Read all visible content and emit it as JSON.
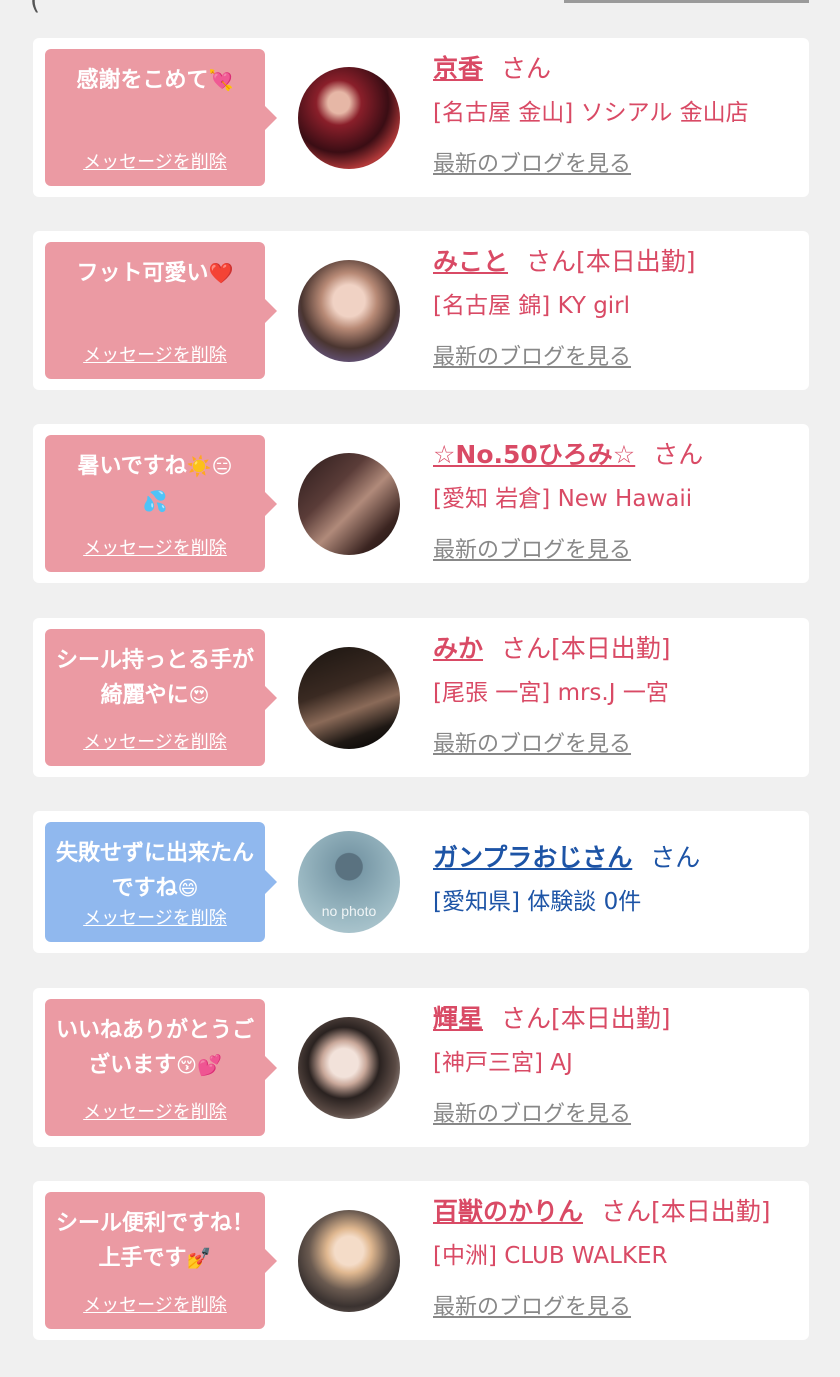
{
  "header": {
    "fragment": "(",
    "underline": ""
  },
  "cards": [
    {
      "color": "pink",
      "message": "感謝をこめて",
      "emoji": "💘",
      "delete_label": "メッセージを削除",
      "name": "京香",
      "san": "さん",
      "status": "",
      "shop": "[名古屋 金山] ソシアル 金山店",
      "blog": "最新のブログを見る",
      "avatar_icon": "photo-avatar"
    },
    {
      "color": "pink",
      "message": "フット可愛い",
      "emoji": "❤️",
      "delete_label": "メッセージを削除",
      "name": "みこと",
      "san": "さん",
      "status": "[本日出勤]",
      "shop": "[名古屋 錦] KY girl",
      "blog": "最新のブログを見る",
      "avatar_icon": "photo-avatar"
    },
    {
      "color": "pink",
      "message": "暑いですね",
      "emoji": "☀️😑💦",
      "delete_label": "メッセージを削除",
      "name": "☆No.50ひろみ☆",
      "san": "さん",
      "status": "",
      "shop": "[愛知 岩倉] New Hawaii",
      "blog": "最新のブログを見る",
      "avatar_icon": "photo-avatar"
    },
    {
      "color": "pink",
      "message": "シール持っとる手が綺麗やに",
      "emoji": "😍",
      "delete_label": "メッセージを削除",
      "name": "みか",
      "san": "さん",
      "status": "[本日出勤]",
      "shop": "[尾張 一宮] mrs.J 一宮",
      "blog": "最新のブログを見る",
      "avatar_icon": "photo-avatar"
    },
    {
      "color": "blue",
      "message": "失敗せずに出来たんですね",
      "emoji": "😄",
      "delete_label": "メッセージを削除",
      "name": "ガンプラおじさん",
      "san": "さん",
      "status": "",
      "shop": "[愛知県] 体験談 0件",
      "blog": "",
      "avatar_icon": "no-photo-avatar",
      "avatar_label": "no photo"
    },
    {
      "color": "pink",
      "message": "いいねありがとうございます",
      "emoji": "😚💕",
      "delete_label": "メッセージを削除",
      "name": "輝星",
      "san": "さん",
      "status": "[本日出勤]",
      "shop": "[神戸三宮] AJ",
      "blog": "最新のブログを見る",
      "avatar_icon": "photo-avatar"
    },
    {
      "color": "pink",
      "message": "シール便利ですね！上手です",
      "emoji": "💅",
      "delete_label": "メッセージを削除",
      "name": "百獣のかりん",
      "san": "さん",
      "status": "[本日出勤]",
      "shop": "[中洲] CLUB WALKER",
      "blog": "最新のブログを見る",
      "avatar_icon": "photo-avatar"
    }
  ],
  "colors": {
    "page_bg": "#f0f0f0",
    "card_bg": "#ffffff",
    "bubble_pink": "#eb9aa3",
    "bubble_blue": "#90b8ee",
    "name_pink": "#d94a65",
    "name_blue": "#1d54a6",
    "blog_gray": "#888888"
  }
}
